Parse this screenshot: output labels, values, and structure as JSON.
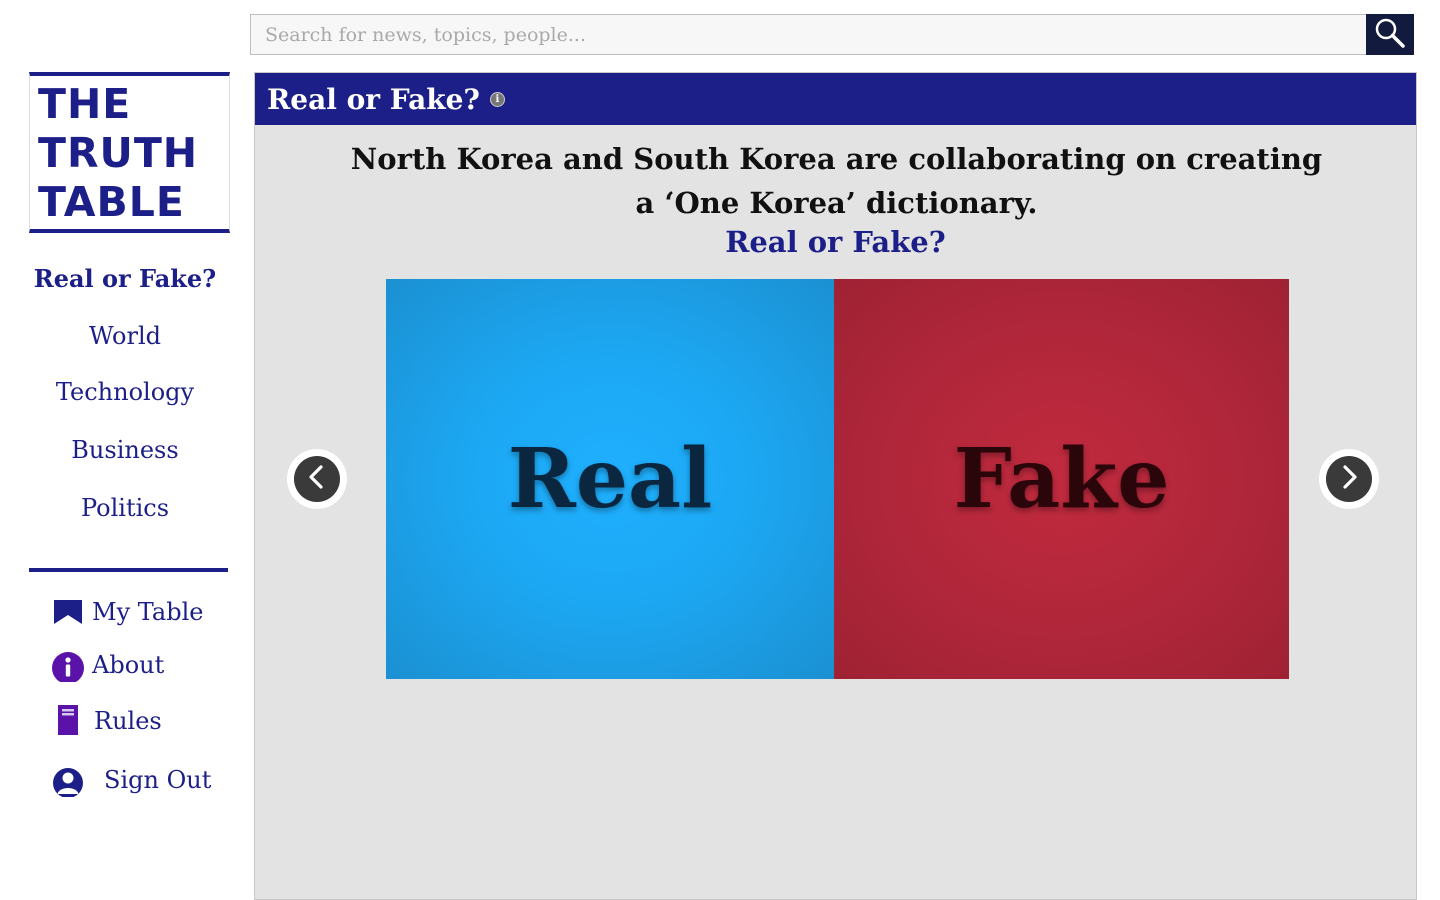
{
  "search": {
    "placeholder": "Search for news, topics, people..."
  },
  "logo": {
    "lines": [
      "THE",
      "TRUTH",
      "TABLE"
    ]
  },
  "nav": {
    "items": [
      {
        "label": "Real or Fake?"
      },
      {
        "label": "World"
      },
      {
        "label": "Technology"
      },
      {
        "label": "Business"
      },
      {
        "label": "Politics"
      }
    ]
  },
  "utility": {
    "items": [
      {
        "label": "My Table",
        "icon": "bookmark-icon"
      },
      {
        "label": "About",
        "icon": "info-icon"
      },
      {
        "label": "Rules",
        "icon": "book-icon"
      },
      {
        "label": "Sign Out",
        "icon": "user-icon"
      }
    ]
  },
  "panel": {
    "title": "Real or Fake?",
    "headline": "North Korea and South Korea are collaborating on creating a ‘One Korea’ dictionary.",
    "prompt": "Real or Fake?",
    "real_label": "Real",
    "fake_label": "Fake"
  },
  "colors": {
    "brand": "#1c1f87",
    "real": "#1ca7f2",
    "fake": "#b0263a",
    "search_button": "#121a3d"
  }
}
